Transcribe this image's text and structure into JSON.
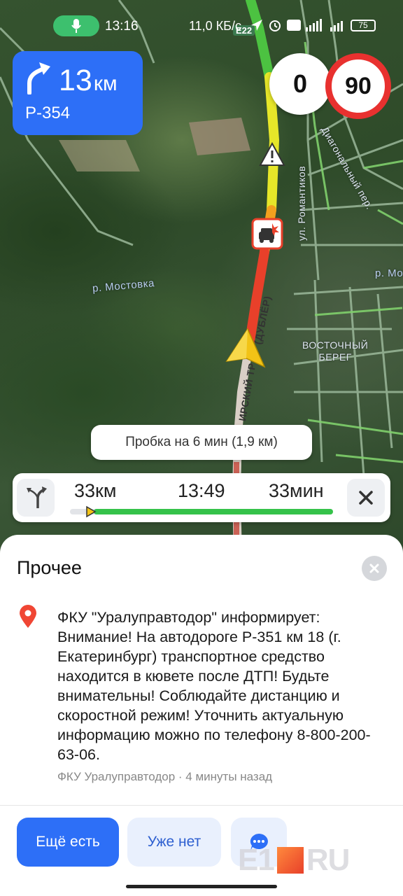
{
  "status_bar": {
    "time": "13:16",
    "network_speed": "11,0 КБ/с",
    "battery": "75",
    "road_shield": "E22"
  },
  "maneuver": {
    "distance_value": "13",
    "distance_unit": "км",
    "road": "Р-354",
    "icon": "turn-right-arrow-icon"
  },
  "speed": {
    "current": "0",
    "limit": "90"
  },
  "map": {
    "labels": {
      "river": "р. Мостовка",
      "river2": "р. Мос",
      "street_romantikov": "ул. Романтиков",
      "street_diagonal": "Диагональный пер.",
      "district": "ВОСТОЧНЫЙ\nБЕРЕГ",
      "road_tract": "ИРСКИЙ ТР",
      "road_dubler": "(ДУБЛЁР)"
    }
  },
  "traffic_tip": "Пробка на 6 мин (1,9 км)",
  "route_bar": {
    "distance": "33км",
    "arrival": "13:49",
    "duration": "33мин",
    "progress": 0.09
  },
  "sheet": {
    "title": "Прочее",
    "message": "ФКУ \"Уралуправтодор\" информирует: Внимание! На автодороге Р-351 км 18 (г. Екатеринбург)  транспортное средство находится в кювете после ДТП! Будьте внимательны! Соблюдайте дистанцию и скоростной режим! Уточнить актуальную информацию можно по телефону 8-800-200-63-06.",
    "source": "ФКУ Уралуправтодор · 4 минуты назад",
    "btn_still_there": "Ещё есть",
    "btn_gone": "Уже нет"
  },
  "watermark": {
    "left": "E1",
    "right": "RU"
  },
  "colors": {
    "accent_blue": "#2d6ff7",
    "speed_limit_red": "#e8312f",
    "traffic_green": "#35c24a",
    "traffic_red": "#e8402a"
  }
}
